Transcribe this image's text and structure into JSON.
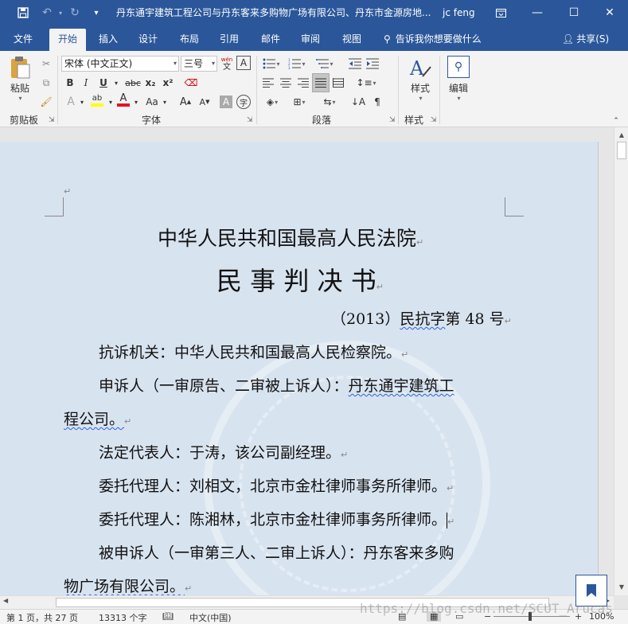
{
  "window": {
    "title": "丹东通宇建筑工程公司与丹东客来多购物广场有限公司、丹东市金源房地...",
    "user": "jc feng"
  },
  "tabs": [
    "文件",
    "开始",
    "插入",
    "设计",
    "布局",
    "引用",
    "邮件",
    "审阅",
    "视图"
  ],
  "tellme": "告诉我你想要做什么",
  "share": "共享(S)",
  "ribbon": {
    "clipboard_label": "剪贴板",
    "paste_label": "粘贴",
    "font_label": "字体",
    "paragraph_label": "段落",
    "styles_label": "样式",
    "styles_button": "样式",
    "edit_button": "编辑",
    "font_name": "宋体 (中文正文)",
    "font_size": "三号",
    "wen_glyph": "wén",
    "wen_char": "文",
    "a_boxed": "A",
    "bold": "B",
    "italic": "I",
    "underline": "U",
    "strike": "abc",
    "subscript": "x₂",
    "superscript": "x²",
    "font_a_small": "A",
    "highlight_glyph": "ab",
    "font_color_glyph": "A",
    "case_glyph": "Aa",
    "grow_glyph": "A",
    "shrink_glyph": "A",
    "char_shade_glyph": "A",
    "enclose_glyph": "字"
  },
  "document": {
    "line1": "中华人民共和国最高人民法院",
    "line2": "民 事 判 决 书",
    "case_prefix": "（2013）",
    "case_wavy": "民抗字",
    "case_suffix": "第 48 号",
    "p1": "抗诉机关：中华人民共和国最高人民检察院。",
    "p2a": "申诉人（一审原告、二审被上诉人）：",
    "p2b": "丹东通宇建筑工",
    "p2c": "程公司。",
    "p3": "法定代表人：于涛，该公司副经理。",
    "p4": "委托代理人：刘相文，北京市金杜律师事务所律师。",
    "p5": "委托代理人：陈湘林，北京市金杜律师事务所律师。",
    "p6": "被申诉人（一审第三人、二审上诉人）：丹东客来多购",
    "p7": "物广场有限公司。",
    "para_mark": "↵"
  },
  "status": {
    "page": "第 1 页，共 27 页",
    "words": "13313 个字",
    "lang": "中文(中国)",
    "zoom": "100%"
  },
  "watermark": "https://blog.csdn.net/SCUT_Arucas",
  "colors": {
    "accent": "#2b579a",
    "page_bg": "#d8e3f0",
    "font_color_bar": "#e81123",
    "highlight_bar": "#ffff00"
  }
}
